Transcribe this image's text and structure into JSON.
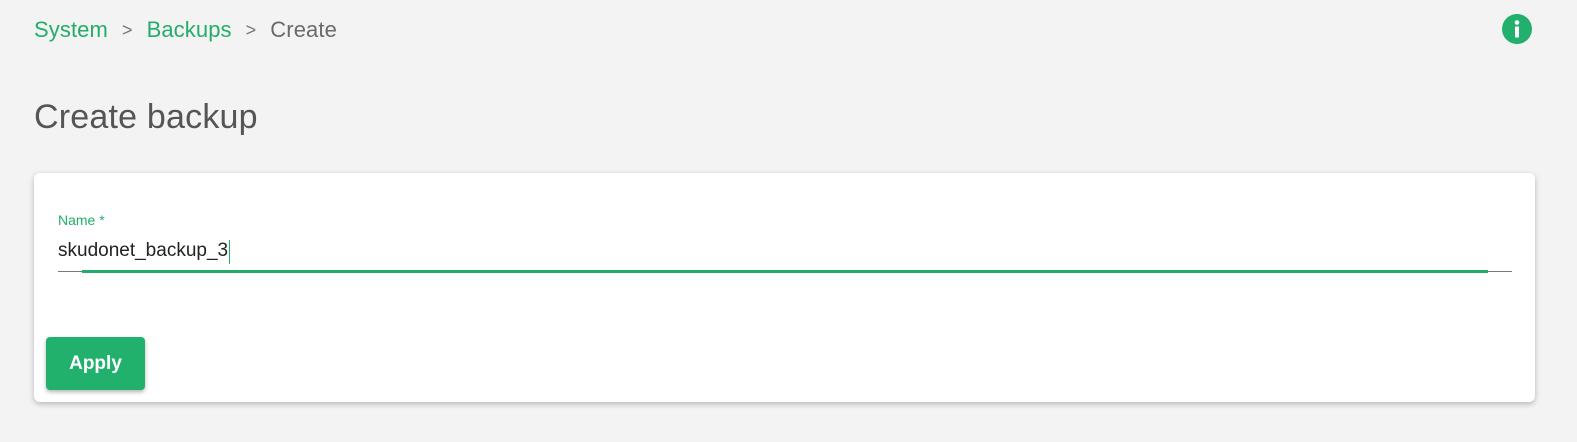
{
  "breadcrumb": {
    "items": [
      {
        "label": "System"
      },
      {
        "label": "Backups"
      },
      {
        "label": "Create"
      }
    ],
    "separator": ">"
  },
  "header": {
    "info_icon": "info-icon"
  },
  "page": {
    "title": "Create backup"
  },
  "form": {
    "name_label": "Name *",
    "name_value": "skudonet_backup_3",
    "apply_label": "Apply"
  },
  "colors": {
    "accent": "#24ad6a",
    "background": "#f3f3f3",
    "card": "#ffffff",
    "title_text": "#555555"
  }
}
